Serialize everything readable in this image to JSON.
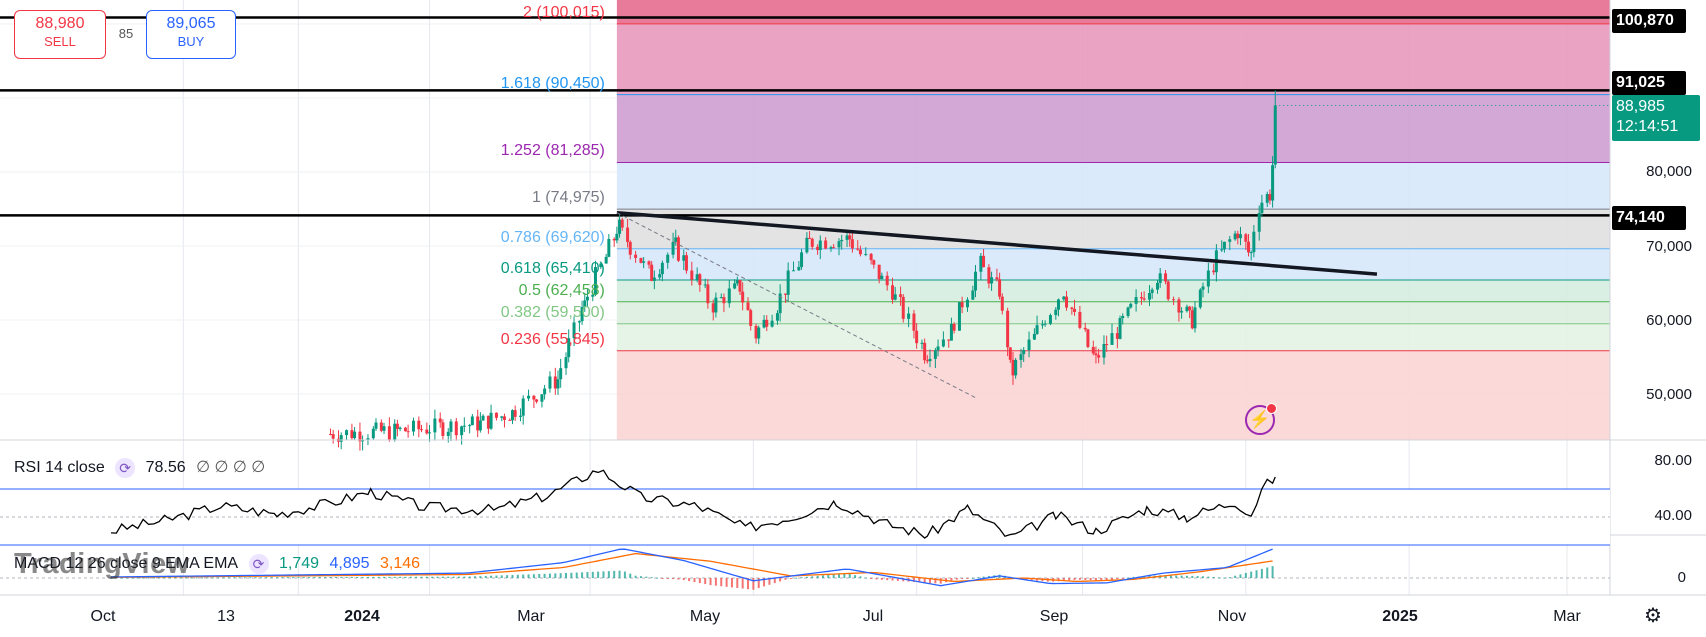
{
  "trade": {
    "sell_price": "88,980",
    "sell_label": "SELL",
    "buy_price": "89,065",
    "buy_label": "BUY",
    "spread": "85"
  },
  "price_axis": {
    "tick_labels": [
      "80,000",
      "70,000",
      "60,000",
      "50,000"
    ],
    "marker_100870": "100,870",
    "marker_91025": "91,025",
    "marker_74140": "74,140",
    "last_price": "88,985",
    "countdown": "12:14:51"
  },
  "rsi_axis": {
    "tick_labels": [
      "80.00",
      "40.00"
    ]
  },
  "macd_axis": {
    "tick_labels": [
      "0"
    ]
  },
  "time_axis": {
    "labels": [
      "Oct",
      "13",
      "2024",
      "Mar",
      "May",
      "Jul",
      "Sep",
      "Nov",
      "2025",
      "Mar"
    ]
  },
  "legend": {
    "rsi_title": "RSI 14 close",
    "rsi_value": "78.56",
    "rsi_empty": "∅ ∅ ∅ ∅",
    "macd_title": "MACD 12 26 close 9 EMA EMA",
    "macd_value": "1,749",
    "signal_value": "4,895",
    "hist_value": "3,146"
  },
  "watermark": "TradingView",
  "icons": {
    "settings": "gear-icon",
    "alert": "lightning-icon",
    "legend_toggle": "cycle-icon"
  },
  "colors": {
    "up": "#089981",
    "down": "#f23645",
    "rsi_line": "#000000",
    "macd_line": "#2962ff",
    "signal_line": "#ff6d00"
  },
  "chart_data": {
    "type": "candlestick",
    "main": {
      "ylim": [
        44500,
        103000
      ],
      "last_price": 88985,
      "horizontal_lines": [
        100870,
        91025,
        74140
      ],
      "fib_levels": [
        {
          "ratio": "2",
          "value": 100015,
          "label": "2 (100,015)",
          "color": "#f23645"
        },
        {
          "ratio": "1.618",
          "value": 90450,
          "label": "1.618 (90,450)",
          "color": "#2196f3"
        },
        {
          "ratio": "1.252",
          "value": 81285,
          "label": "1.252 (81,285)",
          "color": "#9c27b0"
        },
        {
          "ratio": "1",
          "value": 74975,
          "label": "1 (74,975)",
          "color": "#787b86"
        },
        {
          "ratio": "0.786",
          "value": 69620,
          "label": "0.786 (69,620)",
          "color": "#64b5f6"
        },
        {
          "ratio": "0.618",
          "value": 65410,
          "label": "0.618 (65,410)",
          "color": "#089981"
        },
        {
          "ratio": "0.5",
          "value": 62458,
          "label": "0.5 (62,458)",
          "color": "#4caf50"
        },
        {
          "ratio": "0.382",
          "value": 59500,
          "label": "0.382 (59,500)",
          "color": "#81c784"
        },
        {
          "ratio": "0.236",
          "value": 55845,
          "label": "0.236 (55,845)",
          "color": "#f23645"
        }
      ],
      "trendline": [
        {
          "date": "2024-03-11",
          "price": 74500
        },
        {
          "date": "2024-12-20",
          "price": 66200
        }
      ],
      "dashed_line": [
        {
          "date": "2024-03-11",
          "price": 74500
        },
        {
          "date": "2024-07-23",
          "price": 49500
        }
      ],
      "ohlc_anchors": [
        {
          "date": "2023-11-25",
          "price": 44600
        },
        {
          "date": "2023-12-20",
          "price": 45000
        },
        {
          "date": "2024-01-20",
          "price": 46000
        },
        {
          "date": "2024-02-01",
          "price": 47500
        },
        {
          "date": "2024-02-18",
          "price": 52000
        },
        {
          "date": "2024-02-28",
          "price": 62000
        },
        {
          "date": "2024-03-12",
          "price": 72500
        },
        {
          "date": "2024-03-24",
          "price": 66000
        },
        {
          "date": "2024-04-02",
          "price": 70000
        },
        {
          "date": "2024-04-16",
          "price": 62000
        },
        {
          "date": "2024-04-26",
          "price": 64500
        },
        {
          "date": "2024-05-02",
          "price": 58000
        },
        {
          "date": "2024-05-10",
          "price": 62000
        },
        {
          "date": "2024-05-22",
          "price": 70500
        },
        {
          "date": "2024-06-06",
          "price": 71000
        },
        {
          "date": "2024-06-22",
          "price": 64000
        },
        {
          "date": "2024-07-05",
          "price": 55500
        },
        {
          "date": "2024-07-14",
          "price": 58500
        },
        {
          "date": "2024-07-25",
          "price": 67500
        },
        {
          "date": "2024-08-01",
          "price": 64000
        },
        {
          "date": "2024-08-06",
          "price": 53000
        },
        {
          "date": "2024-08-25",
          "price": 64000
        },
        {
          "date": "2024-09-06",
          "price": 54500
        },
        {
          "date": "2024-09-15",
          "price": 59000
        },
        {
          "date": "2024-09-29",
          "price": 66000
        },
        {
          "date": "2024-10-12",
          "price": 60000
        },
        {
          "date": "2024-10-20",
          "price": 67500
        },
        {
          "date": "2024-10-29",
          "price": 72000
        },
        {
          "date": "2024-11-03",
          "price": 69000
        },
        {
          "date": "2024-11-06",
          "price": 75500
        },
        {
          "date": "2024-11-10",
          "price": 77000
        },
        {
          "date": "2024-11-11",
          "price": 81000
        },
        {
          "date": "2024-11-12",
          "price": 88985
        }
      ]
    },
    "rsi": {
      "period": 14,
      "ylim": [
        20,
        100
      ],
      "bands": [
        70,
        30
      ],
      "midline": 50,
      "last": 78.56,
      "points": [
        {
          "date": "2023-09-04",
          "value": 40
        },
        {
          "date": "2023-09-25",
          "value": 48
        },
        {
          "date": "2023-10-15",
          "value": 58
        },
        {
          "date": "2023-11-05",
          "value": 52
        },
        {
          "date": "2023-11-25",
          "value": 60
        },
        {
          "date": "2023-12-10",
          "value": 68
        },
        {
          "date": "2023-12-30",
          "value": 57
        },
        {
          "date": "2024-01-25",
          "value": 55
        },
        {
          "date": "2024-02-15",
          "value": 66
        },
        {
          "date": "2024-03-04",
          "value": 84
        },
        {
          "date": "2024-03-20",
          "value": 64
        },
        {
          "date": "2024-04-10",
          "value": 58
        },
        {
          "date": "2024-04-28",
          "value": 42
        },
        {
          "date": "2024-05-15",
          "value": 50
        },
        {
          "date": "2024-06-01",
          "value": 61
        },
        {
          "date": "2024-06-20",
          "value": 45
        },
        {
          "date": "2024-07-05",
          "value": 37
        },
        {
          "date": "2024-07-20",
          "value": 56
        },
        {
          "date": "2024-08-05",
          "value": 35
        },
        {
          "date": "2024-08-22",
          "value": 51
        },
        {
          "date": "2024-09-06",
          "value": 40
        },
        {
          "date": "2024-09-25",
          "value": 56
        },
        {
          "date": "2024-10-10",
          "value": 50
        },
        {
          "date": "2024-10-28",
          "value": 61
        },
        {
          "date": "2024-11-03",
          "value": 52
        },
        {
          "date": "2024-11-07",
          "value": 70
        },
        {
          "date": "2024-11-12",
          "value": 78.56
        }
      ]
    },
    "macd": {
      "params": [
        12,
        26,
        9
      ],
      "ylim": [
        -1500,
        5500
      ],
      "macd": 1749,
      "signal": 4895,
      "histogram": 3146,
      "macd_line": [
        {
          "date": "2023-09-04",
          "value": 150
        },
        {
          "date": "2024-01-15",
          "value": 700
        },
        {
          "date": "2024-02-20",
          "value": 2200
        },
        {
          "date": "2024-03-13",
          "value": 4200
        },
        {
          "date": "2024-04-05",
          "value": 2500
        },
        {
          "date": "2024-05-01",
          "value": -400
        },
        {
          "date": "2024-06-05",
          "value": 1300
        },
        {
          "date": "2024-07-10",
          "value": -1100
        },
        {
          "date": "2024-08-01",
          "value": 300
        },
        {
          "date": "2024-08-20",
          "value": -800
        },
        {
          "date": "2024-09-10",
          "value": -700
        },
        {
          "date": "2024-10-01",
          "value": 700
        },
        {
          "date": "2024-10-25",
          "value": 1500
        },
        {
          "date": "2024-11-12",
          "value": 4300
        }
      ],
      "signal_line": [
        {
          "date": "2023-09-04",
          "value": 100
        },
        {
          "date": "2024-01-15",
          "value": 500
        },
        {
          "date": "2024-02-20",
          "value": 1500
        },
        {
          "date": "2024-03-18",
          "value": 3500
        },
        {
          "date": "2024-04-15",
          "value": 2400
        },
        {
          "date": "2024-05-15",
          "value": 300
        },
        {
          "date": "2024-06-15",
          "value": 800
        },
        {
          "date": "2024-07-15",
          "value": -500
        },
        {
          "date": "2024-08-10",
          "value": 0
        },
        {
          "date": "2024-08-30",
          "value": -500
        },
        {
          "date": "2024-09-20",
          "value": -200
        },
        {
          "date": "2024-10-15",
          "value": 900
        },
        {
          "date": "2024-11-12",
          "value": 2500
        }
      ]
    },
    "time_axis": {
      "range": [
        "2023-08-26",
        "2025-03-31"
      ],
      "ticks": [
        {
          "date": "2023-10-01",
          "label": "Oct"
        },
        {
          "date": "2023-11-13",
          "label": "13"
        },
        {
          "date": "2024-01-01",
          "label": "2024"
        },
        {
          "date": "2024-03-01",
          "label": "Mar"
        },
        {
          "date": "2024-05-01",
          "label": "May"
        },
        {
          "date": "2024-07-01",
          "label": "Jul"
        },
        {
          "date": "2024-09-01",
          "label": "Sep"
        },
        {
          "date": "2024-11-01",
          "label": "Nov"
        },
        {
          "date": "2025-01-01",
          "label": "2025"
        },
        {
          "date": "2025-03-01",
          "label": "Mar"
        }
      ]
    }
  }
}
